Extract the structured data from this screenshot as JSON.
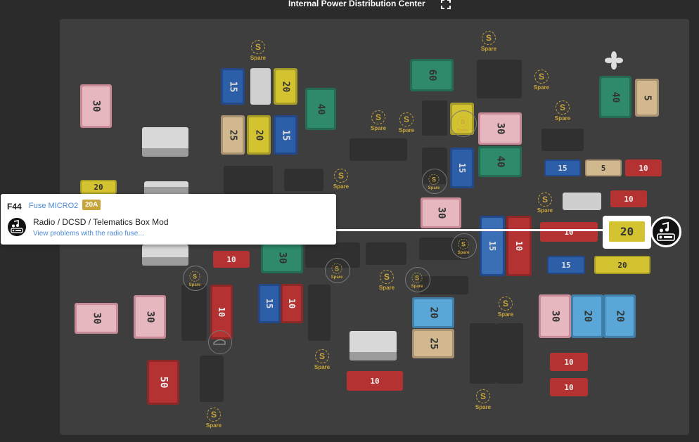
{
  "header": {
    "title": "Internal Power Distribution Center",
    "expand_icon": "fullscreen-icon"
  },
  "spare": {
    "letter": "S",
    "label": "Spare"
  },
  "fuses": {
    "f1": "30",
    "f2": "15",
    "f3": "20",
    "f4": "40",
    "f5": "25",
    "f6": "20",
    "f7": "15",
    "f8": "60",
    "f9": "30",
    "f10": "40",
    "f11": "5",
    "f12": "15",
    "f13": "5",
    "f14": "10",
    "f15": "20",
    "f16": "10",
    "f17": "10",
    "f18": "40",
    "f19": "30",
    "f20": "30",
    "f21": "10",
    "f22": "15",
    "f23": "10",
    "f24": "30",
    "f25": "20",
    "f26": "25",
    "f27": "10",
    "f28": "10",
    "f29": "15",
    "f30": "20",
    "f31": "30",
    "f32": "20",
    "f33": "20",
    "f34": "10",
    "f35": "10",
    "f36": "50",
    "f37": "10",
    "f38": "30",
    "f39": "15",
    "f40": "10",
    "f41": "30",
    "f42": "20"
  },
  "tooltip": {
    "id": "F44",
    "type": "Fuse MICRO2",
    "rating": "20A",
    "icon": "music-radio-icon",
    "description": "Radio / DCSD / Telematics Box Mod",
    "link": "View problems with the radio fuse..."
  },
  "selected": {
    "value": "20",
    "icon": "music-radio-icon"
  },
  "colors": {
    "red": "#b53232",
    "yellow": "#d4c331",
    "blue": "#2d5fa8",
    "green": "#2e8a6a",
    "pink": "#d89aa6",
    "tan": "#d2b88e",
    "lightblue": "#5aa6d6",
    "spare_gold": "#c9a53a"
  }
}
